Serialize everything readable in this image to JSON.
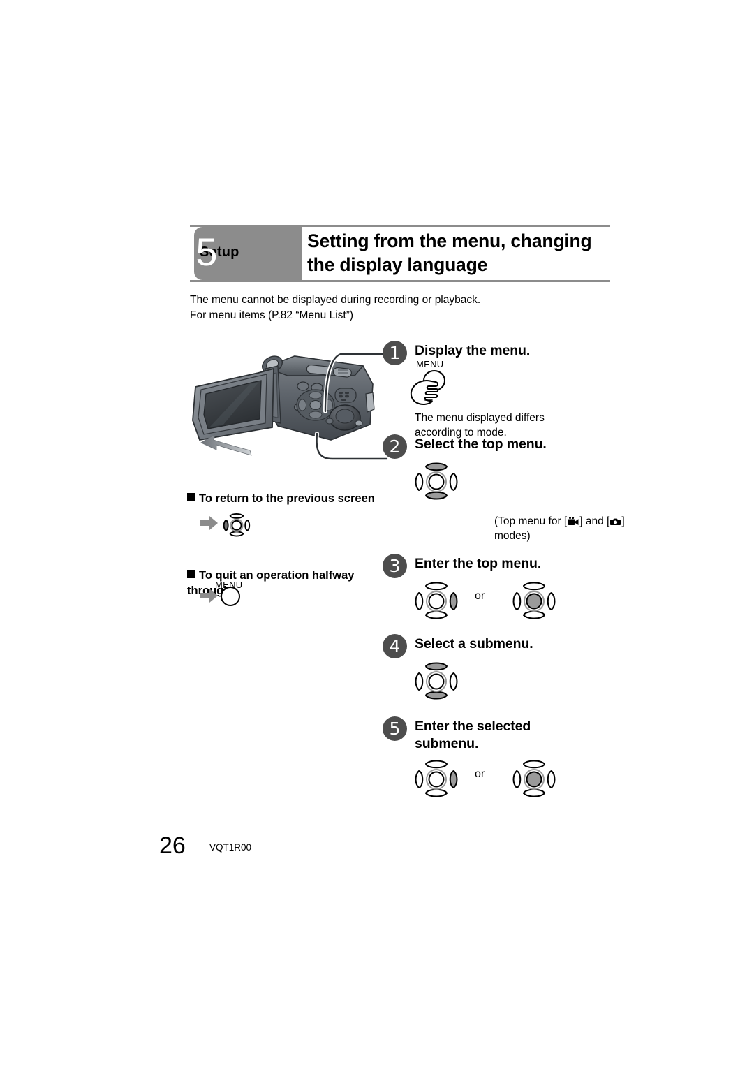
{
  "header": {
    "tab_label": "Setup",
    "number": "5",
    "title": "Setting from the menu,\nchanging the display language"
  },
  "intro": {
    "line1": "The menu cannot be displayed during recording or playback.",
    "line2": "For menu items (P.82 “Menu List”)"
  },
  "steps": [
    {
      "number": "1",
      "title": "Display the menu.",
      "button_label": "MENU",
      "note": "The menu displayed differs\naccording to mode."
    },
    {
      "number": "2",
      "title": "Select the top menu.",
      "note": "(Top menu for [ ] and [ ]\nmodes)",
      "note_prefix": "(Top menu for [",
      "note_middle": "] and [",
      "note_suffix": "]",
      "note_line2": "modes)"
    },
    {
      "number": "3",
      "title": "Enter the top menu.",
      "or_label": "or"
    },
    {
      "number": "4",
      "title": "Select a submenu."
    },
    {
      "number": "5",
      "title": "Enter the selected\nsubmenu.",
      "or_label": "or"
    }
  ],
  "sections": [
    {
      "heading": "To return to the previous screen"
    },
    {
      "heading": "To quit an operation halfway\nthrough",
      "button_label": "MENU"
    }
  ],
  "footer": {
    "page_number": "26",
    "document_code": "VQT1R00"
  },
  "colors": {
    "header_gray": "#8c8c8c",
    "step_circle": "#4d4d4d",
    "joystick_highlight": "#9a9a9a",
    "arrow_gray": "#8c8c8c",
    "rule_gray": "#8c8c8c"
  }
}
